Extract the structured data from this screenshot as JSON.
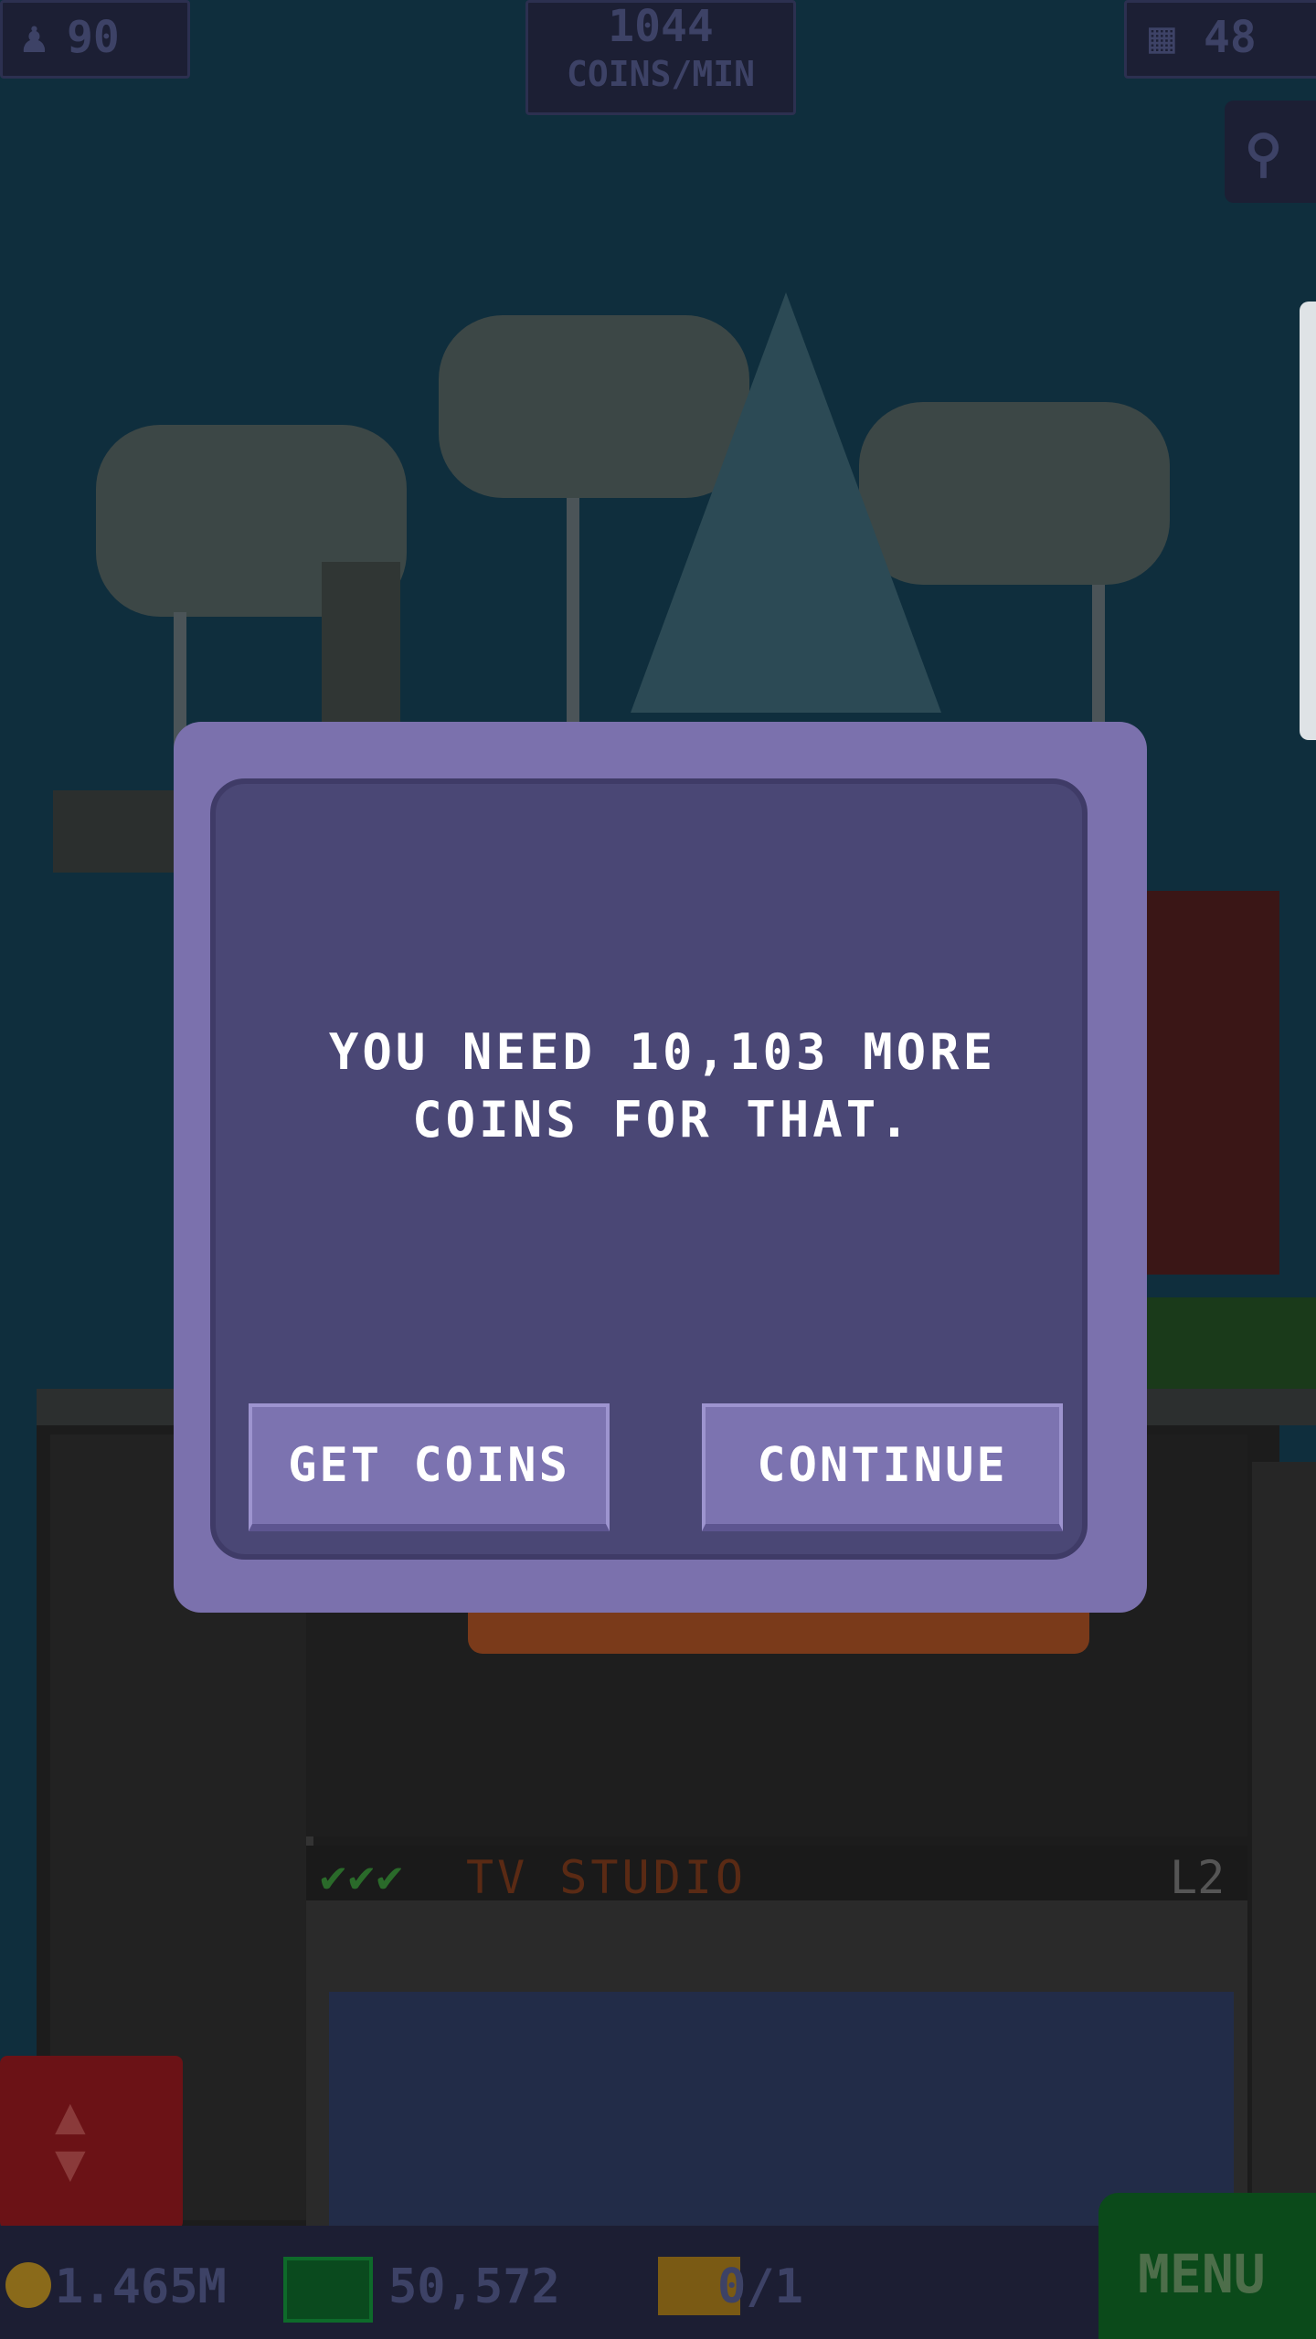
{
  "hud": {
    "population": "90",
    "coins_per_min_value": "1044",
    "coins_per_min_label": "COINS/MIN",
    "floors": "48"
  },
  "dialog": {
    "message": "YOU NEED 10,103 MORE COINS FOR THAT.",
    "get_coins_label": "GET COINS",
    "continue_label": "CONTINUE"
  },
  "tower": {
    "floor_name": "TV STUDIO",
    "floor_level": "L2",
    "checks": "✔✔✔"
  },
  "bottom_bar": {
    "coins": "1.465M",
    "bux": "50,572",
    "tickets": "0/1",
    "menu_label": "MENU"
  },
  "colors": {
    "modal_outer": "#7b71ad",
    "modal_inner": "#4a4775",
    "button": "#7c73b0",
    "menu": "#0b4a1a",
    "elevator_button": "#6b1216"
  }
}
